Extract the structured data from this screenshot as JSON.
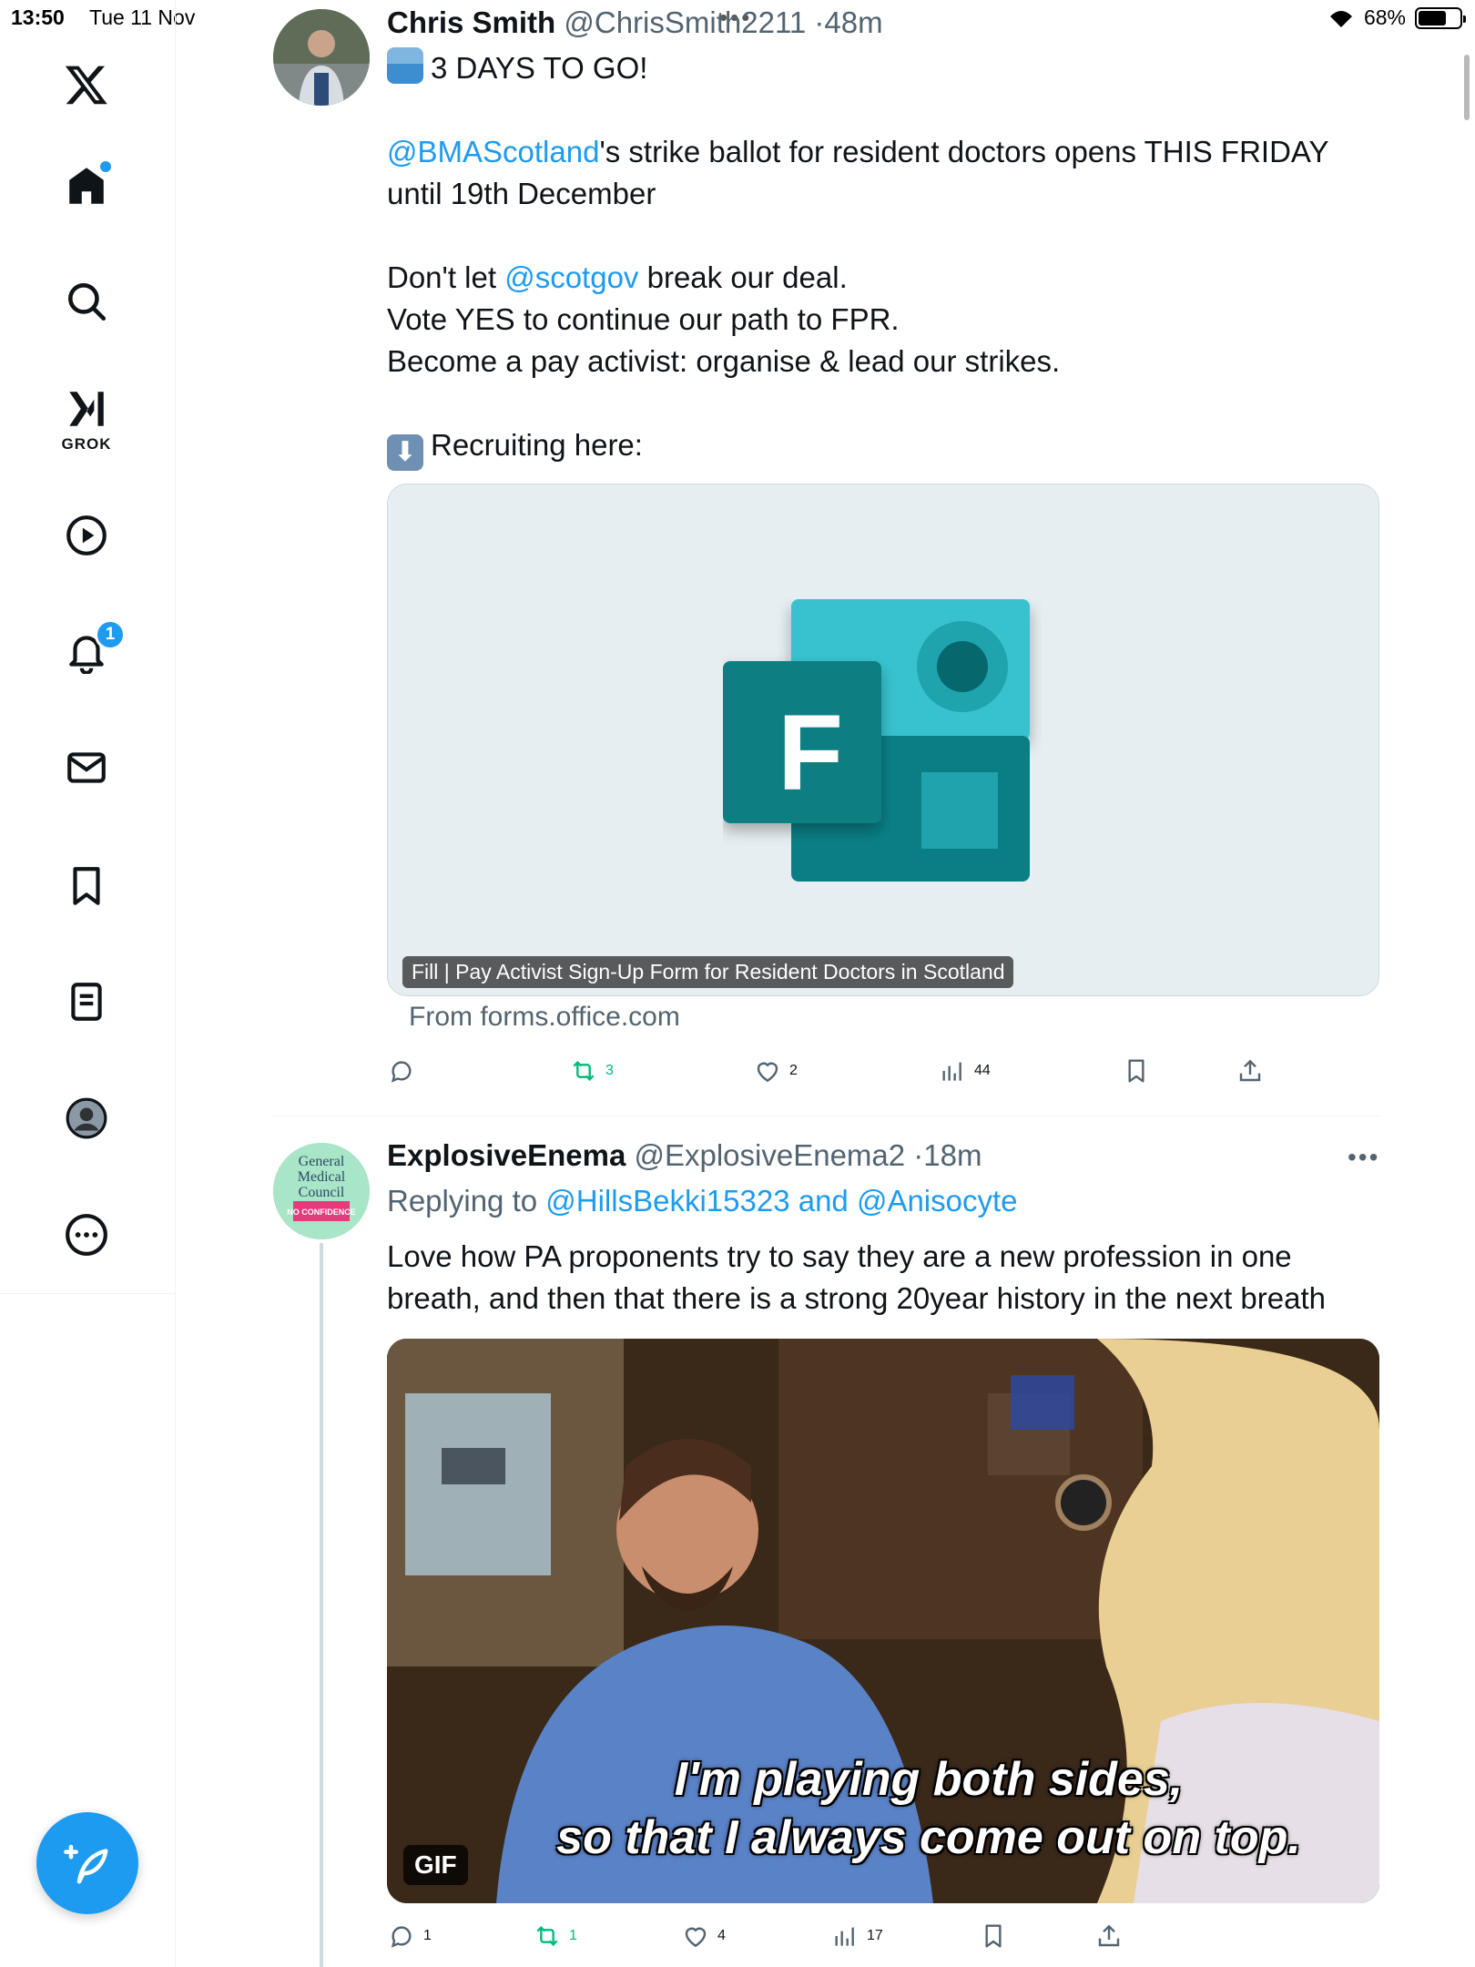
{
  "status_bar": {
    "time": "13:50",
    "date": "Tue 11 Nov",
    "dots": "•••",
    "battery_percent": "68%",
    "battery_level": 0.68
  },
  "sidebar": {
    "logo_icon": "x-logo-icon",
    "items": [
      {
        "name": "home",
        "icon": "home-icon",
        "has_dot": true
      },
      {
        "name": "explore",
        "icon": "search-icon"
      },
      {
        "name": "grok",
        "icon": "grok-icon",
        "label": "GROK"
      },
      {
        "name": "video",
        "icon": "play-icon"
      },
      {
        "name": "notifications",
        "icon": "bell-icon",
        "badge": "1"
      },
      {
        "name": "messages",
        "icon": "mail-icon"
      },
      {
        "name": "bookmarks",
        "icon": "bookmark-icon"
      },
      {
        "name": "lists",
        "icon": "list-icon"
      },
      {
        "name": "profile",
        "icon": "profile-icon"
      },
      {
        "name": "more",
        "icon": "more-icon"
      }
    ],
    "compose_icon": "compose-icon",
    "accent": "#1d9bf0"
  },
  "tweets": [
    {
      "name": "Chris Smith",
      "handle": "@ChrisSmith2211",
      "time_sep": "·",
      "time": "48m",
      "line1": "3 DAYS TO GO!",
      "para1_mention": "@BMAScotland",
      "para1_rest1": "'s strike ballot for resident doctors opens THIS FRIDAY",
      "para1_rest2": "until 19th December",
      "para2_pre": "Don't let ",
      "para2_mention": "@scotgov",
      "para2_post": " break our deal.",
      "para2_line2": "Vote YES to continue our path to FPR.",
      "para2_line3": "Become a pay activist: organise & lead our strikes.",
      "para3": "Recruiting here:",
      "card_caption": "Fill | Pay Activist Sign-Up Form for Resident Doctors in Scotland",
      "card_from": "From forms.office.com",
      "card_logo_letter": "F",
      "actions": {
        "replies": "",
        "retweets": "3",
        "likes": "2",
        "views": "44"
      }
    },
    {
      "name": "ExplosiveEnema",
      "handle": "@ExplosiveEnema2",
      "time_sep": "·",
      "time": "18m",
      "more": "•••",
      "replying_prefix": "Replying to ",
      "replying_to": "@HillsBekki15323 and @Anisocyte",
      "text_line1": "Love how PA proponents try to say they are a new profession in one",
      "text_line2": "breath, and then that there is a strong 20year history in the next breath",
      "avatar_text": [
        "General",
        "Medical",
        "Council"
      ],
      "avatar_stamp": "NO CONFIDENCE",
      "gif_label": "GIF",
      "gif_sub1": "I'm playing both sides,",
      "gif_sub2": "so that I always come out on top.",
      "actions": {
        "replies": "1",
        "retweets": "1",
        "likes": "4",
        "views": "17"
      }
    }
  ],
  "colors": {
    "link": "#1d9bf0",
    "retweet": "#00ba7c",
    "muted": "#536471"
  }
}
